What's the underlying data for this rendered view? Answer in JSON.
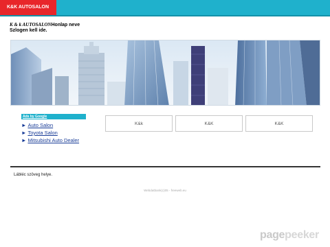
{
  "header": {
    "brand_tab": "K&K AUTOSALON"
  },
  "site": {
    "name_brand": "K & k AUTOSALON",
    "name_suffix": "Honlap neve",
    "slogan": "Szlogen kell ide."
  },
  "hero": {
    "description_icon": "city-skyscrapers-image"
  },
  "sidebar": {
    "ad_label": "Ads by Google",
    "links": [
      {
        "arrow": "►",
        "label": "Auto Salon"
      },
      {
        "arrow": "►",
        "label": "Toyota Salon"
      },
      {
        "arrow": "►",
        "label": "Mitsubishi Auto Dealer"
      }
    ]
  },
  "boxes": [
    {
      "label": "K&k"
    },
    {
      "label": "K&K"
    },
    {
      "label": "K&K"
    }
  ],
  "footer": {
    "text": "Lábléc szöveg helye.",
    "credit": "Webdatbank(c)05 - freeweb.eu"
  },
  "watermark": {
    "part1": "page",
    "part2": "peeker"
  },
  "colors": {
    "topbar": "#1fb1cc",
    "brand_tab": "#e8262a",
    "link": "#163a96"
  }
}
